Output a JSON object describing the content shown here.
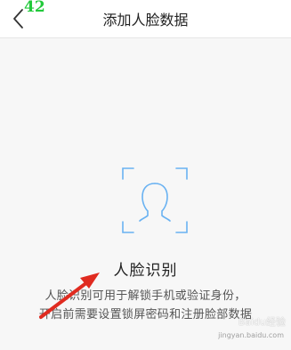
{
  "header": {
    "title": "添加人脸数据",
    "step_badge": "42"
  },
  "face_section": {
    "heading": "人脸识别",
    "description_line1": "人脸识别可用于解锁手机或验证身份，",
    "description_line2": "开启前需要设置锁屏密码和注册脸部数据"
  },
  "watermark": {
    "text": "Baidu经验",
    "url": "jingyan.baidu.com"
  },
  "colors": {
    "frame_blue": "#69b2f2",
    "annotation_red": "#e02b20",
    "badge_green": "#22c93b"
  }
}
